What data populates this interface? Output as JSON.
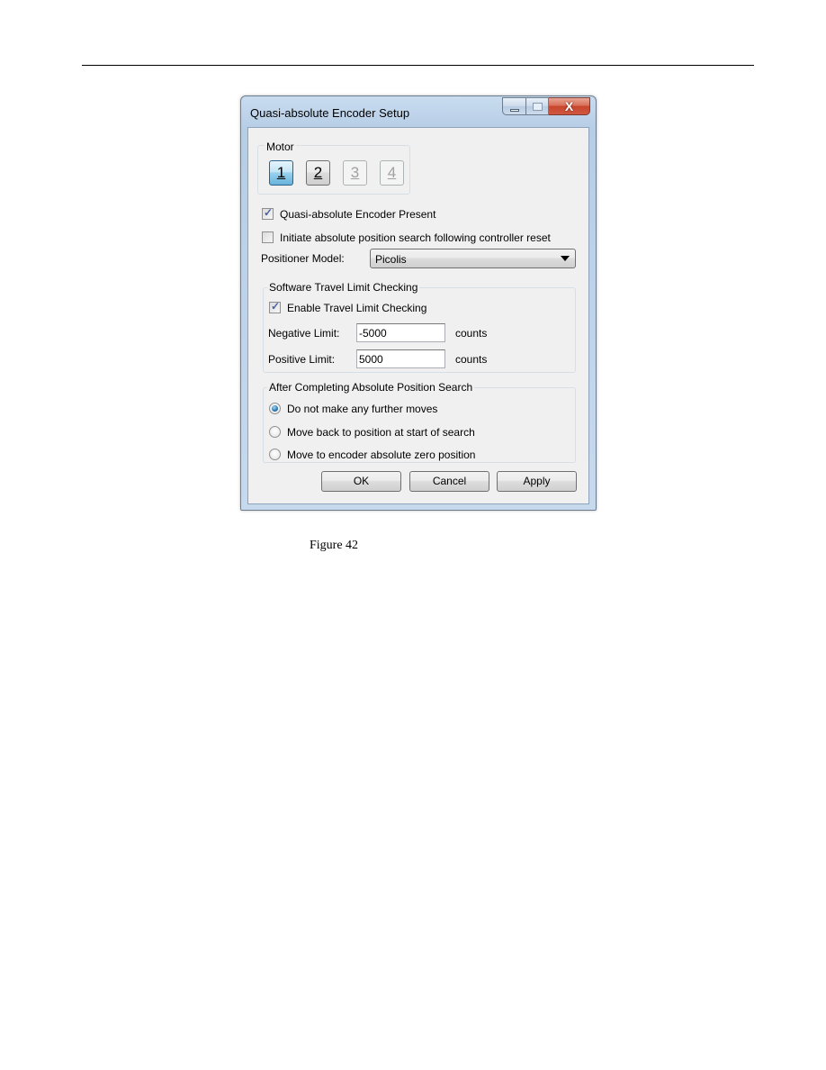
{
  "page": {
    "figure_caption": "Figure 42"
  },
  "window": {
    "title": "Quasi-absolute Encoder Setup",
    "caption_buttons": {
      "minimize_icon": "minimize-icon",
      "maximize_icon": "maximize-icon",
      "close_icon": "close-icon",
      "close_glyph": "X",
      "close_color": "#c8452d"
    }
  },
  "motor": {
    "label": "Motor",
    "buttons": [
      {
        "label": "1",
        "state": "active"
      },
      {
        "label": "2",
        "state": "normal"
      },
      {
        "label": "3",
        "state": "disabled"
      },
      {
        "label": "4",
        "state": "disabled"
      }
    ]
  },
  "options": {
    "encoder_present": {
      "label": "Quasi-absolute Encoder Present",
      "checked": true
    },
    "initiate_search": {
      "label": "Initiate absolute position search following controller reset",
      "checked": false
    }
  },
  "positioner_model": {
    "label": "Positioner Model:",
    "value": "Picolis"
  },
  "travel_limit": {
    "group_label": "Software Travel Limit Checking",
    "enable": {
      "label": "Enable Travel Limit Checking",
      "checked": true
    },
    "negative": {
      "label": "Negative Limit:",
      "value": "-5000",
      "unit": "counts"
    },
    "positive": {
      "label": "Positive Limit:",
      "value": "5000",
      "unit": "counts"
    }
  },
  "after_search": {
    "group_label": "After Completing Absolute Position Search",
    "options": [
      {
        "label": "Do not make any further moves",
        "selected": true
      },
      {
        "label": "Move back to position at start of search",
        "selected": false
      },
      {
        "label": "Move to encoder absolute zero position",
        "selected": false
      }
    ]
  },
  "buttons": {
    "ok": "OK",
    "cancel": "Cancel",
    "apply": "Apply"
  },
  "colors": {
    "active_motor_button": "#68b3db",
    "radio_selected": "#2d79b5",
    "check_mark": "#4b61a5"
  }
}
